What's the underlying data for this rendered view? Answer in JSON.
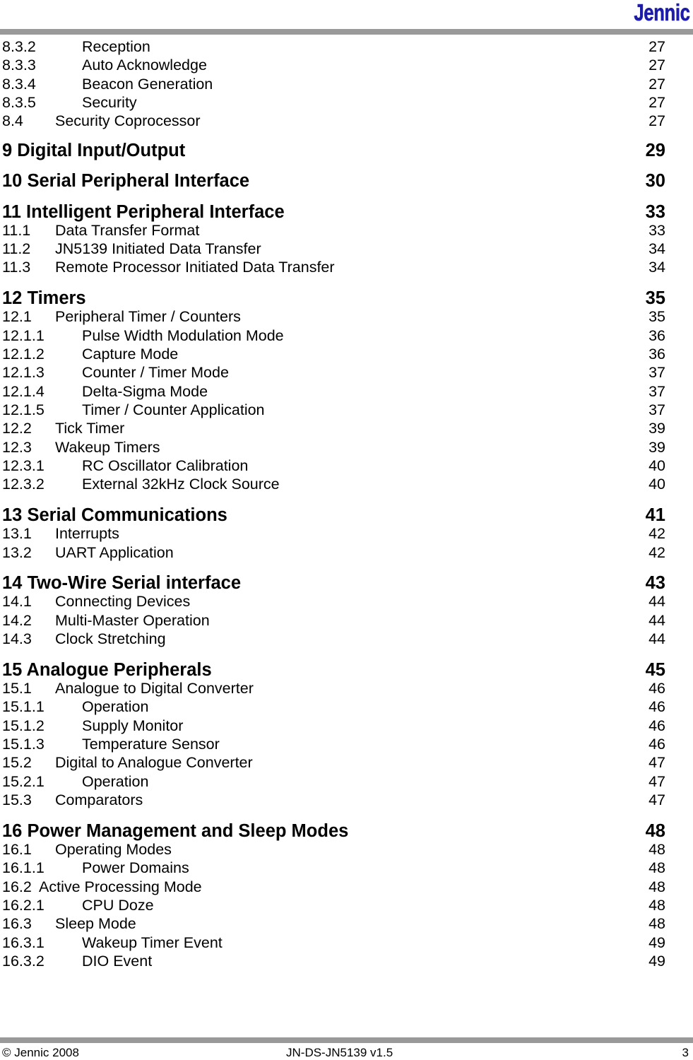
{
  "header": {
    "logo": "Jennic"
  },
  "toc": [
    {
      "level": 3,
      "num": "8.3.2",
      "title": "Reception",
      "page": "27"
    },
    {
      "level": 3,
      "num": "8.3.3",
      "title": "Auto Acknowledge",
      "page": "27"
    },
    {
      "level": 3,
      "num": "8.3.4",
      "title": "Beacon Generation",
      "page": "27"
    },
    {
      "level": 3,
      "num": "8.3.5",
      "title": "Security",
      "page": "27"
    },
    {
      "level": 2,
      "num": "8.4",
      "title": "Security Coprocessor",
      "page": "27"
    },
    {
      "level": 1,
      "num": "",
      "title": "9 Digital Input/Output",
      "page": "29"
    },
    {
      "level": 1,
      "num": "",
      "title": "10 Serial Peripheral Interface",
      "page": "30"
    },
    {
      "level": 1,
      "num": "",
      "title": "11 Intelligent Peripheral Interface",
      "page": "33"
    },
    {
      "level": 2,
      "num": "11.1",
      "title": "Data Transfer Format",
      "page": "33"
    },
    {
      "level": 2,
      "num": "11.2",
      "title": "JN5139 Initiated Data Transfer",
      "page": "34"
    },
    {
      "level": 2,
      "num": "11.3",
      "title": "Remote Processor Initiated Data Transfer",
      "page": "34"
    },
    {
      "level": 1,
      "num": "",
      "title": "12 Timers",
      "page": "35"
    },
    {
      "level": 2,
      "num": "12.1",
      "title": "Peripheral Timer / Counters",
      "page": "35"
    },
    {
      "level": 3,
      "num": "12.1.1",
      "title": "Pulse Width Modulation Mode",
      "page": "36"
    },
    {
      "level": 3,
      "num": "12.1.2",
      "title": "Capture Mode",
      "page": "36"
    },
    {
      "level": 3,
      "num": "12.1.3",
      "title": "Counter / Timer Mode",
      "page": "37"
    },
    {
      "level": 3,
      "num": "12.1.4",
      "title": "Delta-Sigma Mode",
      "page": "37"
    },
    {
      "level": 3,
      "num": "12.1.5",
      "title": "Timer / Counter Application",
      "page": "37"
    },
    {
      "level": 2,
      "num": "12.2",
      "title": "Tick Timer",
      "page": "39"
    },
    {
      "level": 2,
      "num": "12.3",
      "title": "Wakeup Timers",
      "page": "39"
    },
    {
      "level": 3,
      "num": "12.3.1",
      "title": "RC Oscillator Calibration",
      "page": "40"
    },
    {
      "level": 3,
      "num": "12.3.2",
      "title": "External 32kHz Clock Source",
      "page": "40"
    },
    {
      "level": 1,
      "num": "",
      "title": "13 Serial Communications",
      "page": "41"
    },
    {
      "level": 2,
      "num": "13.1",
      "title": "Interrupts",
      "page": "42"
    },
    {
      "level": 2,
      "num": "13.2",
      "title": "UART Application",
      "page": "42"
    },
    {
      "level": 1,
      "num": "",
      "title": "14 Two-Wire Serial interface",
      "page": "43"
    },
    {
      "level": 2,
      "num": "14.1",
      "title": "Connecting Devices",
      "page": "44"
    },
    {
      "level": 2,
      "num": "14.2",
      "title": "Multi-Master Operation",
      "page": "44"
    },
    {
      "level": 2,
      "num": "14.3",
      "title": "Clock Stretching",
      "page": "44"
    },
    {
      "level": 1,
      "num": "",
      "title": "15 Analogue Peripherals",
      "page": "45"
    },
    {
      "level": 2,
      "num": "15.1",
      "title": "Analogue to Digital Converter",
      "page": "46"
    },
    {
      "level": 3,
      "num": "15.1.1",
      "title": "Operation",
      "page": "46"
    },
    {
      "level": 3,
      "num": "15.1.2",
      "title": "Supply Monitor",
      "page": "46"
    },
    {
      "level": 3,
      "num": "15.1.3",
      "title": "Temperature Sensor",
      "page": "46"
    },
    {
      "level": 2,
      "num": "15.2",
      "title": "Digital to Analogue Converter",
      "page": "47"
    },
    {
      "level": 3,
      "num": "15.2.1",
      "title": "Operation",
      "page": "47"
    },
    {
      "level": 2,
      "num": "15.3",
      "title": "Comparators",
      "page": "47"
    },
    {
      "level": 1,
      "num": "",
      "title": "16 Power Management and Sleep Modes",
      "page": "48"
    },
    {
      "level": 2,
      "num": "16.1",
      "title": "Operating Modes",
      "page": "48"
    },
    {
      "level": 3,
      "num": "16.1.1",
      "title": "Power Domains",
      "page": "48"
    },
    {
      "level": "2inline",
      "num": "16.2",
      "title": "Active Processing Mode",
      "page": "48"
    },
    {
      "level": 3,
      "num": "16.2.1",
      "title": "CPU Doze",
      "page": "48"
    },
    {
      "level": 2,
      "num": "16.3",
      "title": "Sleep Mode",
      "page": "48"
    },
    {
      "level": 3,
      "num": "16.3.1",
      "title": "Wakeup Timer Event",
      "page": "49"
    },
    {
      "level": 3,
      "num": "16.3.2",
      "title": "DIO Event",
      "page": "49"
    }
  ],
  "footer": {
    "copyright": "© Jennic 2008",
    "doc_id": "JN-DS-JN5139 v1.5",
    "page_number": "3"
  }
}
